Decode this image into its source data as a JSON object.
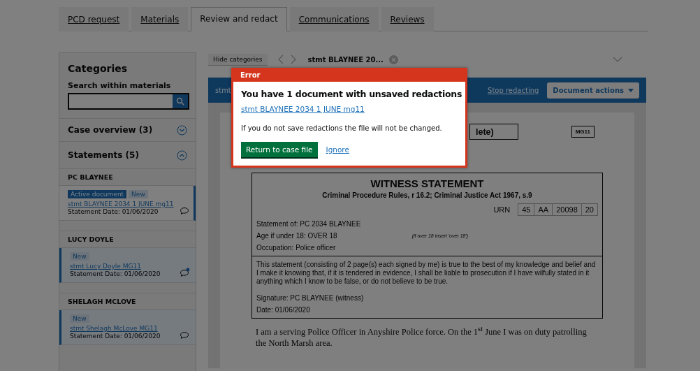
{
  "tabs": [
    {
      "label": "PCD request",
      "selected": false
    },
    {
      "label": "Materials",
      "selected": false
    },
    {
      "label": "Review and redact",
      "selected": true
    },
    {
      "label": "Communications",
      "selected": false
    },
    {
      "label": "Reviews",
      "selected": false
    }
  ],
  "sidebar": {
    "title": "Categories",
    "search_label": "Search within materials",
    "sections": [
      {
        "title": "Case overview (3)",
        "expanded": false
      },
      {
        "title": "Statements (5)",
        "expanded": true,
        "groups": [
          {
            "name": "PC BLAYNEE",
            "documents": [
              {
                "tags": [
                  {
                    "label": "Active document",
                    "kind": "active"
                  },
                  {
                    "label": "New",
                    "kind": "new"
                  }
                ],
                "link": "stmt BLAYNEE 2034 1 JUNE mg11",
                "date": "Statement Date: 01/06/2020",
                "selected": true,
                "unread_comment": false
              }
            ]
          },
          {
            "name": "LUCY DOYLE",
            "documents": [
              {
                "tags": [
                  {
                    "label": "New",
                    "kind": "new"
                  }
                ],
                "link": "stmt Lucy Doyle MG11",
                "date": "Statement Date: 01/06/2020",
                "selected": false,
                "unread_comment": true
              }
            ]
          },
          {
            "name": "SHELAGH MCLOVE",
            "documents": [
              {
                "tags": [
                  {
                    "label": "New",
                    "kind": "new"
                  }
                ],
                "link": "stmt Shelagh McLove MG11",
                "date": "Statement Date: 01/06/2020",
                "selected": false,
                "unread_comment": false
              }
            ]
          }
        ]
      }
    ]
  },
  "viewer": {
    "hide_button": "Hide categories",
    "document_tab": "stmt BLAYNEE 20...",
    "toolbar": {
      "title": "stmt",
      "stop_link": "Stop redacting",
      "actions_button": "Document actions"
    },
    "document": {
      "title_box": "lete)",
      "form_tag": "MG11",
      "heading": "WITNESS STATEMENT",
      "subheading": "Criminal Procedure Rules, r 16.2; Criminal Justice Act 1967, s.9",
      "urn_label": "URN",
      "urn_cells": [
        "45",
        "AA",
        "20098",
        "20"
      ],
      "statement_of": "Statement of: PC 2034 BLAYNEE",
      "age": "Age if under 18: OVER 18",
      "age_note": "(if over 18 insert 'over 18')",
      "occupation": "Occupation:  Police officer",
      "declaration": "This statement (consisting of 2 page(s) each signed by me) is true to the best of my knowledge and belief and I make it knowing that, if it is tendered in evidence, I shall be liable to prosecution if I have wilfully stated in it anything which I know to be false, or do not believe to be true.",
      "signature": "Signature: PC BLAYNEE (witness)",
      "date": "Date:  01/06/2020",
      "body": "I am a serving Police Officer in Anyshire Police force. On the 1$^{st}$ June I was on duty patrolling the North Marsh area."
    }
  },
  "modal": {
    "header": "Error",
    "title": "You have 1 document with unsaved redactions",
    "link": "stmt BLAYNEE 2034 1 JUNE mg11",
    "message": "If you do not save redactions the file will not be changed.",
    "primary_button": "Return to case file",
    "secondary_link": "Ignore"
  }
}
